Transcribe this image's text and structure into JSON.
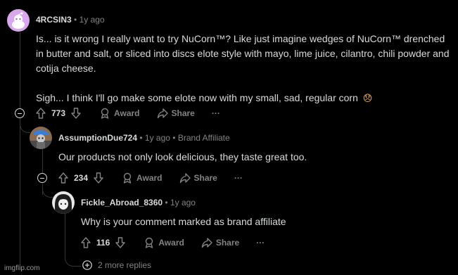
{
  "colors": {
    "background": "#000000",
    "text": "#d7dadc",
    "muted": "#818384",
    "emoji": "#f4b26b"
  },
  "comments": [
    {
      "username": "4RCSIN3",
      "time": "1y ago",
      "paragraphs": [
        "Is... is it wrong I really want to try NuCorn™? Like just imagine wedges of NuCorn™ drenched in butter and salt, or sliced into discs elote style with mayo, lime juice, cilantro, chili powder and cotija cheese.",
        "Sigh... I think I'll go make some elote now with my small, sad, regular corn"
      ],
      "emoji": "😞",
      "votes": "773",
      "award": "Award",
      "share": "Share",
      "more": "···"
    },
    {
      "username": "AssumptionDue724",
      "time": "1y ago",
      "flair": "Brand Affiliate",
      "text": "Our products not only look delicious, they taste great too.",
      "votes": "234",
      "award": "Award",
      "share": "Share",
      "more": "···"
    },
    {
      "username": "Fickle_Abroad_8360",
      "time": "1y ago",
      "text": "Why is your comment marked as brand affiliate",
      "votes": "116",
      "award": "Award",
      "share": "Share",
      "more": "···"
    }
  ],
  "more_replies": "2 more replies",
  "separator": "•",
  "watermark": "imgflip.com"
}
